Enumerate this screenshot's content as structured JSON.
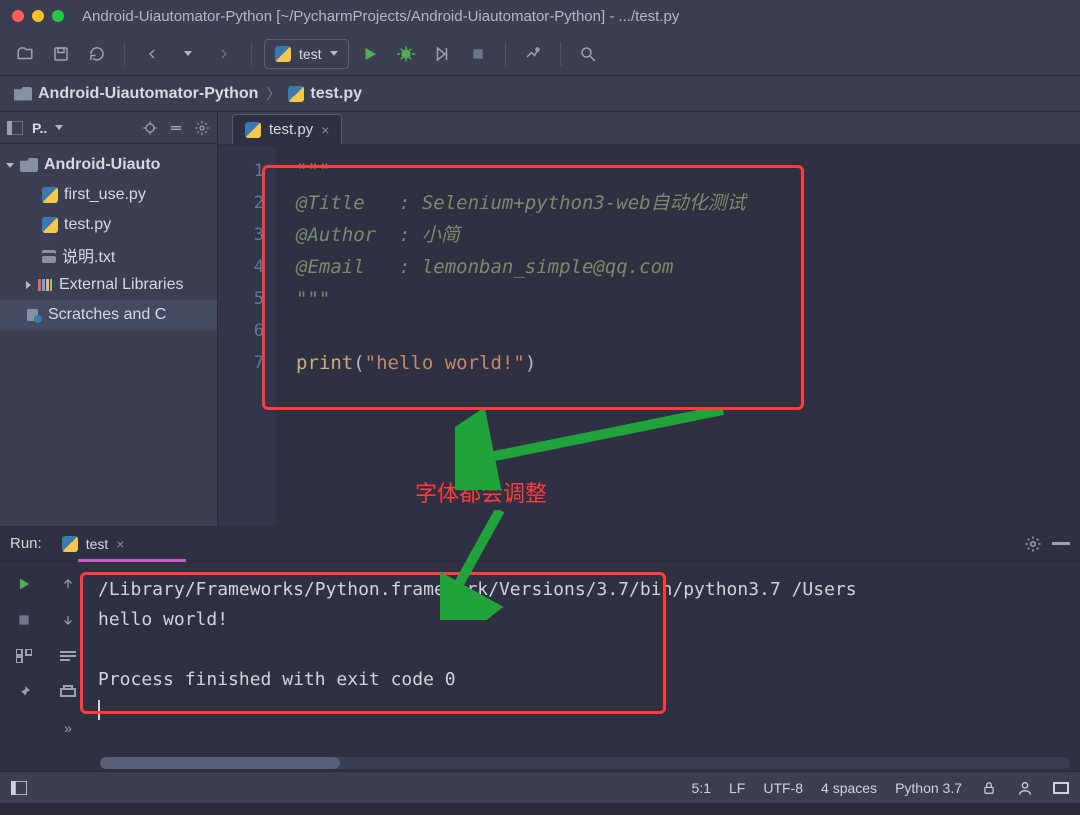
{
  "window": {
    "title": "Android-Uiautomator-Python [~/PycharmProjects/Android-Uiautomator-Python] - .../test.py"
  },
  "toolbar": {
    "config_label": "test"
  },
  "breadcrumb": {
    "root": "Android-Uiautomator-Python",
    "file": "test.py"
  },
  "project": {
    "title": "P..",
    "root": "Android-Uiauto",
    "files": [
      "first_use.py",
      "test.py",
      "说明.txt"
    ],
    "external": "External Libraries",
    "scratches": "Scratches and C"
  },
  "editor": {
    "tab_label": "test.py",
    "lines": {
      "l1": "\"\"\"",
      "l2a": "@Title   : ",
      "l2b": "Selenium+python3-web自动化测试",
      "l3a": "@Author  : ",
      "l3b": "小简",
      "l4a": "@Email   : ",
      "l4b": "lemonban_simple@qq.com",
      "l5": "\"\"\"",
      "l6": "",
      "l7_call": "print",
      "l7_par_open": "(",
      "l7_str": "\"hello world!\"",
      "l7_par_close": ")"
    }
  },
  "run": {
    "label": "Run:",
    "tab": "test",
    "out1": "/Library/Frameworks/Python.framework/Versions/3.7/bin/python3.7 /Users",
    "out2": "hello world!",
    "out3": "Process finished with exit code 0"
  },
  "status": {
    "pos": "5:1",
    "eol": "LF",
    "enc": "UTF-8",
    "indent": "4 spaces",
    "python": "Python 3.7"
  },
  "annotation": {
    "text": "字体都会调整"
  }
}
